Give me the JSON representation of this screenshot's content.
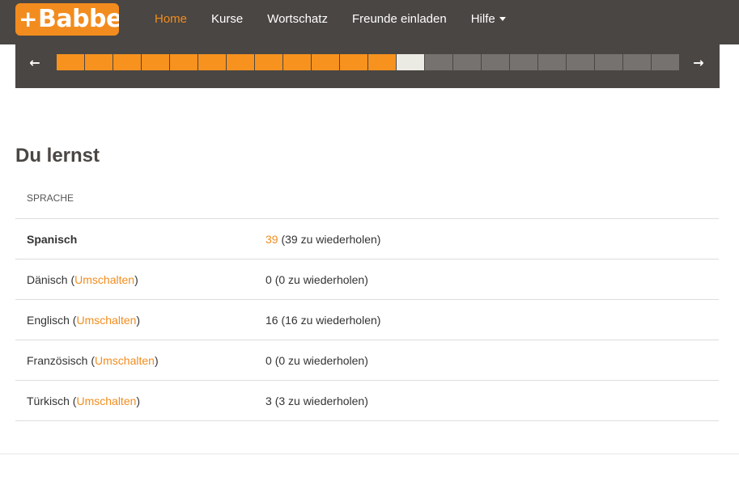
{
  "header": {
    "logo_text": "Babbel",
    "nav": [
      {
        "label": "Home",
        "active": true
      },
      {
        "label": "Kurse"
      },
      {
        "label": "Wortschatz"
      },
      {
        "label": "Freunde einladen"
      },
      {
        "label": "Hilfe"
      }
    ]
  },
  "progress": {
    "total": 22,
    "completed": 12,
    "current_index": 12,
    "colors": {
      "done": "#f7921f",
      "current": "#ecebe3",
      "todo": "#757270"
    }
  },
  "main": {
    "title": "Du lernst",
    "column_header": "SPRACHE",
    "switch_label": "Umschalten",
    "rows": [
      {
        "language": "Spanisch",
        "count": "39",
        "review": "(39 zu wiederholen)",
        "active": true
      },
      {
        "language": "Dänisch",
        "count": "0",
        "review": "(0 zu wiederholen)"
      },
      {
        "language": "Englisch",
        "count": "16",
        "review": "(16 zu wiederholen)"
      },
      {
        "language": "Französisch",
        "count": "0",
        "review": "(0 zu wiederholen)"
      },
      {
        "language": "Türkisch",
        "count": "3",
        "review": "(3 zu wiederholen)"
      }
    ]
  },
  "colors": {
    "accent": "#f28c1e",
    "header_bg": "#4a4643"
  }
}
